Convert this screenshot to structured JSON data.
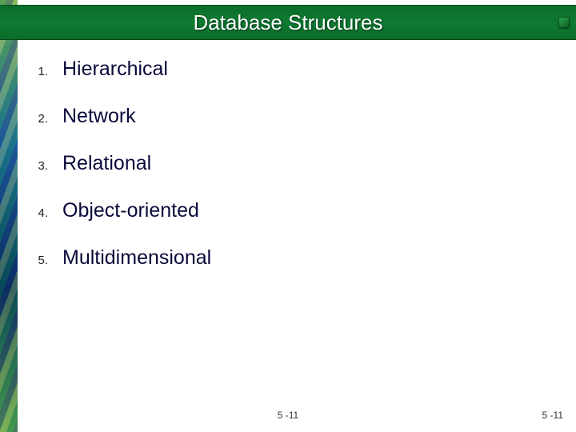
{
  "slide": {
    "title": "Database Structures",
    "items": [
      {
        "num": "1.",
        "label": "Hierarchical"
      },
      {
        "num": "2.",
        "label": "Network"
      },
      {
        "num": "3.",
        "label": "Relational"
      },
      {
        "num": "4.",
        "label": "Object-oriented"
      },
      {
        "num": "5.",
        "label": "Multidimensional"
      }
    ],
    "footer_center": "5 -11",
    "footer_right": "5 -11"
  }
}
